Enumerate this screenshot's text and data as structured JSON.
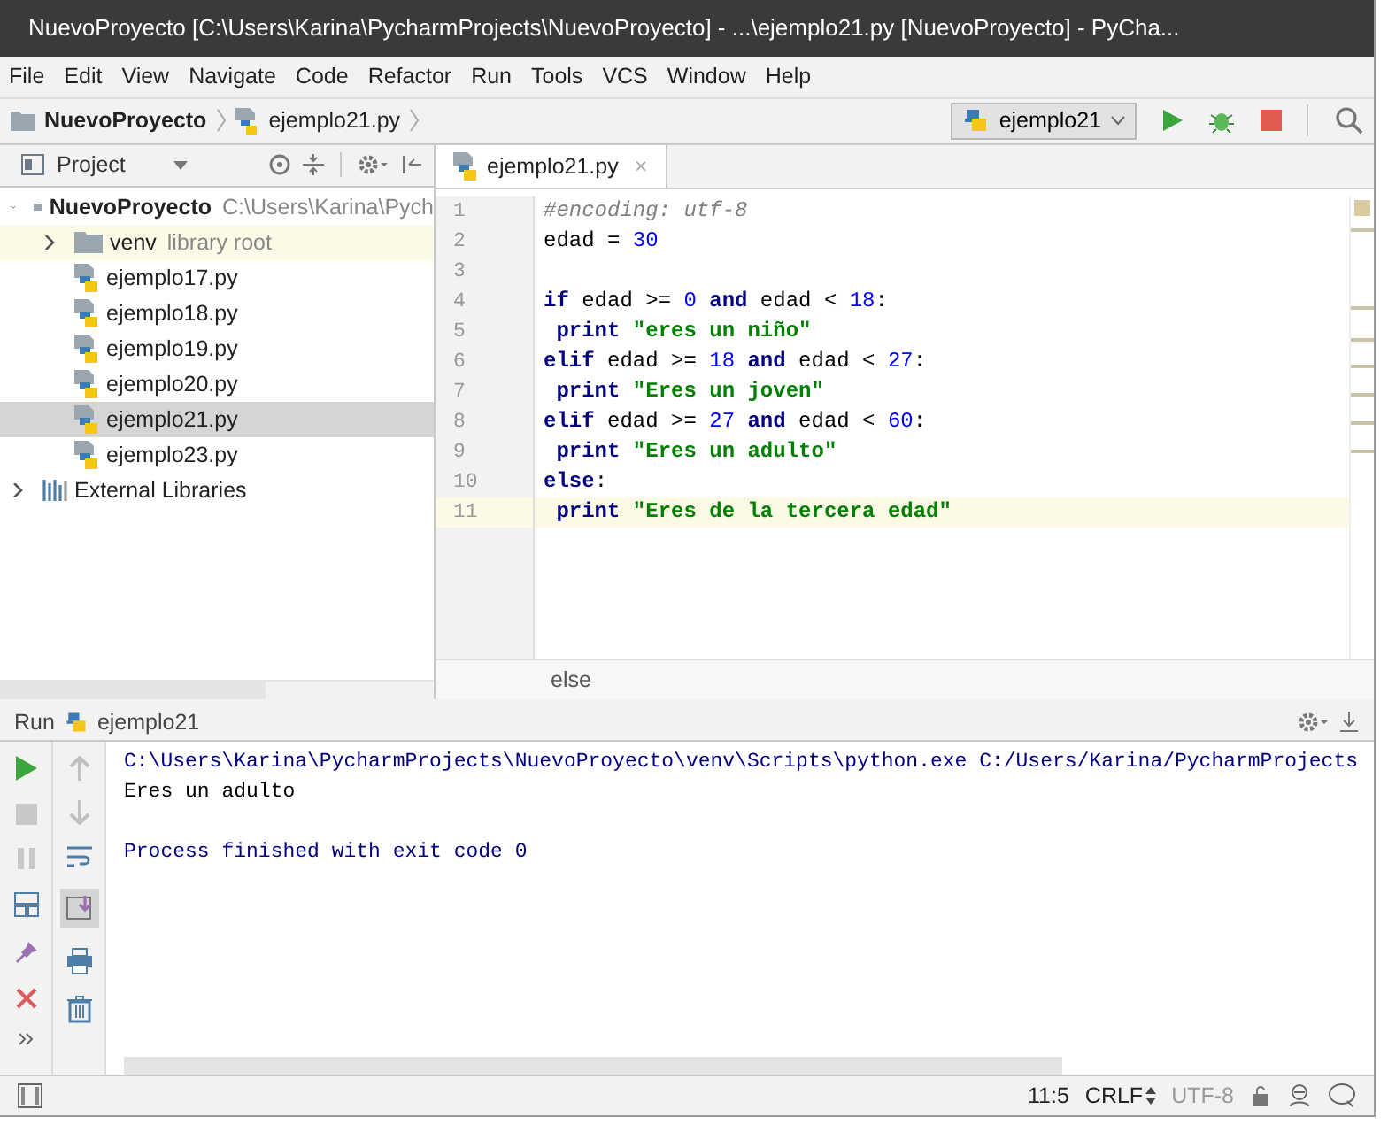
{
  "window": {
    "title": "NuevoProyecto [C:\\Users\\Karina\\PycharmProjects\\NuevoProyecto] - ...\\ejemplo21.py [NuevoProyecto] - PyCha..."
  },
  "menu": [
    "File",
    "Edit",
    "View",
    "Navigate",
    "Code",
    "Refactor",
    "Run",
    "Tools",
    "VCS",
    "Window",
    "Help"
  ],
  "breadcrumbs": [
    {
      "label": "NuevoProyecto",
      "kind": "folder"
    },
    {
      "label": "ejemplo21.py",
      "kind": "python"
    }
  ],
  "run_config": "ejemplo21",
  "project_panel": {
    "title": "Project",
    "tree": [
      {
        "label": "NuevoProyecto",
        "path": "C:\\Users\\Karina\\Pych",
        "kind": "folder",
        "expanded": true,
        "selected": false,
        "highlighted": false,
        "children": [
          {
            "label": "venv",
            "hint": "library root",
            "kind": "folder",
            "expanded": false,
            "selected": false,
            "highlighted": true
          },
          {
            "label": "ejemplo17.py",
            "kind": "python",
            "selected": false,
            "highlighted": false
          },
          {
            "label": "ejemplo18.py",
            "kind": "python",
            "selected": false,
            "highlighted": false
          },
          {
            "label": "ejemplo19.py",
            "kind": "python",
            "selected": false,
            "highlighted": false
          },
          {
            "label": "ejemplo20.py",
            "kind": "python",
            "selected": false,
            "highlighted": false
          },
          {
            "label": "ejemplo21.py",
            "kind": "python",
            "selected": true,
            "highlighted": false
          },
          {
            "label": "ejemplo23.py",
            "kind": "python",
            "selected": false,
            "highlighted": false
          }
        ]
      },
      {
        "label": "External Libraries",
        "kind": "libraries",
        "expanded": false,
        "selected": false,
        "highlighted": false
      }
    ]
  },
  "editor": {
    "tabs": [
      {
        "label": "ejemplo21.py",
        "selected": true,
        "close": "×"
      }
    ],
    "lines": [
      {
        "number": "1",
        "current": false,
        "tokens": [
          {
            "text": "#encoding: utf-8",
            "kind": "comment"
          }
        ]
      },
      {
        "number": "2",
        "current": false,
        "tokens": [
          {
            "text": "edad = ",
            "kind": "plain"
          },
          {
            "text": "30",
            "kind": "num"
          }
        ]
      },
      {
        "number": "3",
        "current": false
      },
      {
        "number": "4",
        "current": false,
        "tokens": [
          {
            "text": "if",
            "kind": "kw"
          },
          {
            "text": " edad >= ",
            "kind": "plain"
          },
          {
            "text": "0",
            "kind": "num"
          },
          {
            "text": " and",
            "kind": "kw"
          },
          {
            "text": " edad < ",
            "kind": "plain"
          },
          {
            "text": "18",
            "kind": "num"
          },
          {
            "text": ":",
            "kind": "plain"
          }
        ]
      },
      {
        "number": "5",
        "current": false,
        "tokens": [
          {
            "text": " print ",
            "kind": "kw"
          },
          {
            "text": "\"eres un niño\"",
            "kind": "str"
          }
        ]
      },
      {
        "number": "6",
        "current": false,
        "tokens": [
          {
            "text": "elif",
            "kind": "kw"
          },
          {
            "text": " edad >= ",
            "kind": "plain"
          },
          {
            "text": "18",
            "kind": "num"
          },
          {
            "text": " and",
            "kind": "kw"
          },
          {
            "text": " edad < ",
            "kind": "plain"
          },
          {
            "text": "27",
            "kind": "num"
          },
          {
            "text": ":",
            "kind": "plain"
          }
        ]
      },
      {
        "number": "7",
        "current": false,
        "tokens": [
          {
            "text": " print ",
            "kind": "kw"
          },
          {
            "text": "\"Eres un joven\"",
            "kind": "str"
          }
        ]
      },
      {
        "number": "8",
        "current": false,
        "tokens": [
          {
            "text": "elif",
            "kind": "kw"
          },
          {
            "text": " edad >= ",
            "kind": "plain"
          },
          {
            "text": "27",
            "kind": "num"
          },
          {
            "text": " and",
            "kind": "kw"
          },
          {
            "text": " edad < ",
            "kind": "plain"
          },
          {
            "text": "60",
            "kind": "num"
          },
          {
            "text": ":",
            "kind": "plain"
          }
        ]
      },
      {
        "number": "9",
        "current": false,
        "tokens": [
          {
            "text": " print ",
            "kind": "kw"
          },
          {
            "text": "\"Eres un adulto\"",
            "kind": "str"
          }
        ]
      },
      {
        "number": "10",
        "current": false,
        "tokens": [
          {
            "text": "else",
            "kind": "kw"
          },
          {
            "text": ":",
            "kind": "plain"
          }
        ]
      },
      {
        "number": "11",
        "current": true,
        "tokens": [
          {
            "text": " print ",
            "kind": "kw"
          },
          {
            "text": "\"Eres de la tercera edad\"",
            "kind": "str"
          }
        ]
      }
    ],
    "breadcrumb": "else"
  },
  "run_panel": {
    "title": "Run",
    "config": "ejemplo21",
    "output": [
      {
        "text": "C:\\Users\\Karina\\PycharmProjects\\NuevoProyecto\\venv\\Scripts\\python.exe C:/Users/Karina/PycharmProjects",
        "kind": "system"
      },
      {
        "text": "Eres un adulto",
        "kind": "stdout"
      },
      {
        "text": "Process finished with exit code 0",
        "kind": "system",
        "gap": true
      }
    ]
  },
  "status_bar": {
    "position": "11:5",
    "line_separator": "CRLF",
    "encoding": "UTF-8"
  }
}
